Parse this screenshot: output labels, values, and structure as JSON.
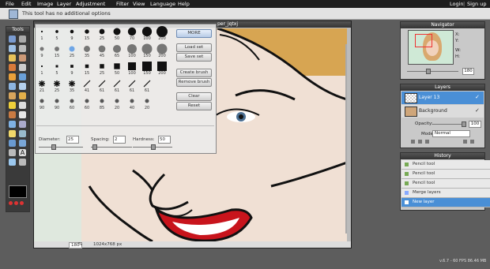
{
  "menu": [
    "File",
    "Edit",
    "Image",
    "Layer",
    "Adjustment",
    "Filter",
    "View",
    "Language",
    "Help"
  ],
  "top_links": {
    "login": "Login",
    "signup": "Sign up",
    "separator": "|"
  },
  "infobar": {
    "text": "This tool has no additional options"
  },
  "tools": {
    "title": "Tools"
  },
  "canvas": {
    "title": "per_jqtxj",
    "zoom": "180",
    "zoom_unit": "%",
    "size": "1024x768 px"
  },
  "brushes": {
    "more": "MORE",
    "load": "Load set",
    "save": "Save set",
    "create": "Create brush",
    "remove": "Remove brush",
    "clear": "Clear",
    "reset": "Reset",
    "diameter_label": "Diameter:",
    "diameter": "25",
    "spacing_label": "Spacing:",
    "spacing": "2",
    "hardness_label": "Hardness:",
    "hardness": "50",
    "row1": [
      "1",
      "5",
      "9",
      "15",
      "25",
      "50",
      "70",
      "100",
      "200"
    ],
    "row2": [
      "9",
      "15",
      "25",
      "35",
      "45",
      "65",
      "100",
      "150",
      "200"
    ],
    "row3": [
      "1",
      "5",
      "9",
      "15",
      "25",
      "50",
      "100",
      "150",
      "200"
    ],
    "row4": [
      "21",
      "25",
      "35",
      "41",
      "61",
      "61",
      "61",
      "61"
    ],
    "row5": [
      "90",
      "90",
      "60",
      "60",
      "85",
      "20",
      "40",
      "20"
    ]
  },
  "navigator": {
    "title": "Navigator",
    "x_label": "X:",
    "y_label": "Y:",
    "w_label": "W:",
    "h_label": "H:",
    "zoom": "180"
  },
  "layers": {
    "title": "Layers",
    "layer1": "Layer 13",
    "layer2": "Background",
    "opacity_label": "Opacity:",
    "opacity": "100",
    "mode_label": "Mode:",
    "mode": "Normal"
  },
  "history": {
    "title": "History",
    "items": [
      "Pencil tool",
      "Pencil tool",
      "Pencil tool",
      "Merge layers",
      "New layer"
    ]
  },
  "version": "v.6.7 - 60 FPS 86.46 MB",
  "colors": {
    "accent": "#4a8fd6",
    "menubar": "#1e1e1e",
    "lips": "#c8141c"
  }
}
